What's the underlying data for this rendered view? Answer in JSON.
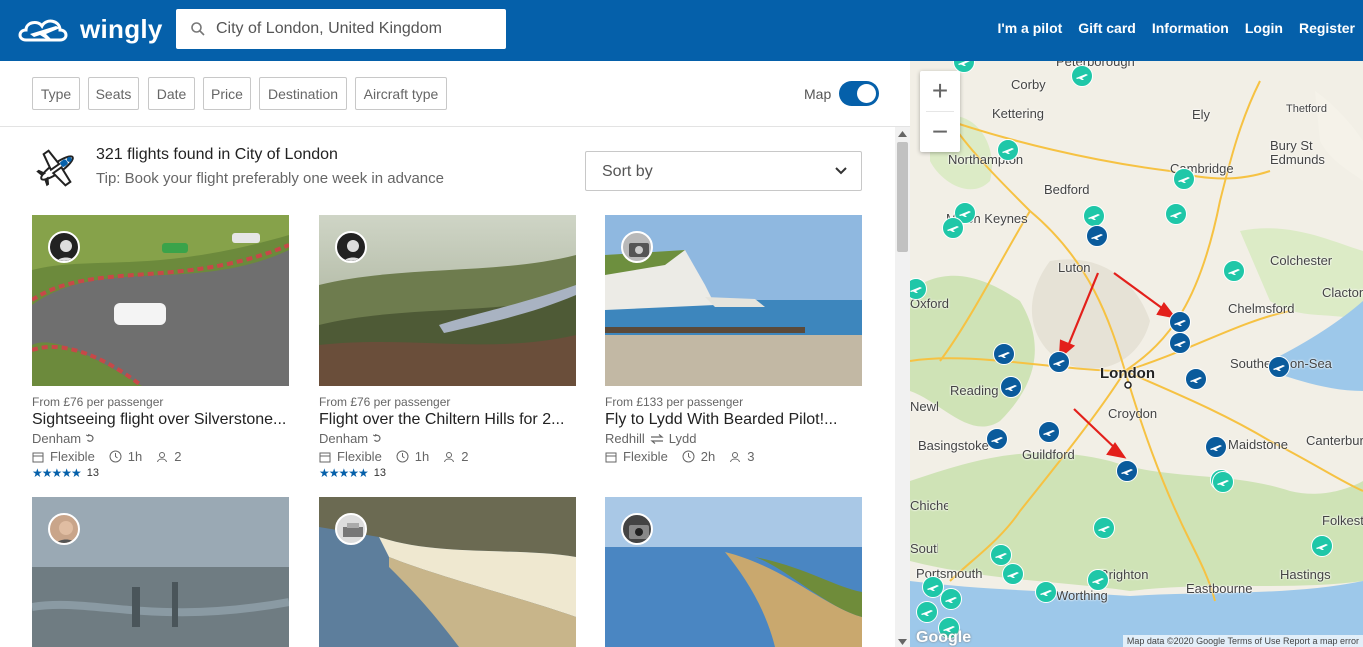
{
  "header": {
    "logo_text": "wingly",
    "search": {
      "value": "City of London, United Kingdom"
    },
    "nav": [
      "I'm a pilot",
      "Gift card",
      "Information",
      "Login",
      "Register"
    ]
  },
  "filters": {
    "buttons": [
      "Type",
      "Seats",
      "Date",
      "Price",
      "Destination",
      "Aircraft type"
    ],
    "map_label": "Map"
  },
  "results": {
    "title": "321 flights found in City of London",
    "tip": "Tip: Book your flight preferably one week in advance",
    "sort_label": "Sort by"
  },
  "cards": [
    {
      "price": "From £76 per passenger",
      "title": "Sightseeing flight over Silverstone...",
      "from": "Denham",
      "to": "",
      "date": "Flexible",
      "duration": "1h",
      "seats": "2",
      "stars": "★★★★★",
      "reviews": "13"
    },
    {
      "price": "From £76 per passenger",
      "title": "Flight over the Chiltern Hills for 2...",
      "from": "Denham",
      "to": "",
      "date": "Flexible",
      "duration": "1h",
      "seats": "2",
      "stars": "★★★★★",
      "reviews": "13"
    },
    {
      "price": "From £133 per passenger",
      "title": "Fly to Lydd With Bearded Pilot!...",
      "from": "Redhill",
      "to": "Lydd",
      "date": "Flexible",
      "duration": "2h",
      "seats": "3",
      "stars": "",
      "reviews": ""
    }
  ],
  "map": {
    "places": [
      "Peterborough",
      "Corby",
      "Kettering",
      "Northampton",
      "Bedford",
      "Cambridge",
      "Ely",
      "Thetford",
      "Bury St Edmunds",
      "Milton Keynes",
      "Luton",
      "Colchester",
      "Oxford",
      "Chelmsford",
      "Clacton",
      "Southend-on-Sea",
      "Reading",
      "London",
      "Croydon",
      "Newbury",
      "Basingstoke",
      "Guildford",
      "Maidstone",
      "Canterbury",
      "Chichester",
      "Portsmouth",
      "Brighton",
      "Worthing",
      "Eastbourne",
      "Hastings",
      "Folkestone",
      "Southampton"
    ],
    "footer": "Map data ©2020 Google   Terms of Use   Report a map error",
    "google": "Google"
  },
  "colors": {
    "brand": "#0560aa",
    "teal_marker": "#1fc7a8",
    "blue_marker": "#0a5b9c",
    "arrow": "#e3201b"
  }
}
